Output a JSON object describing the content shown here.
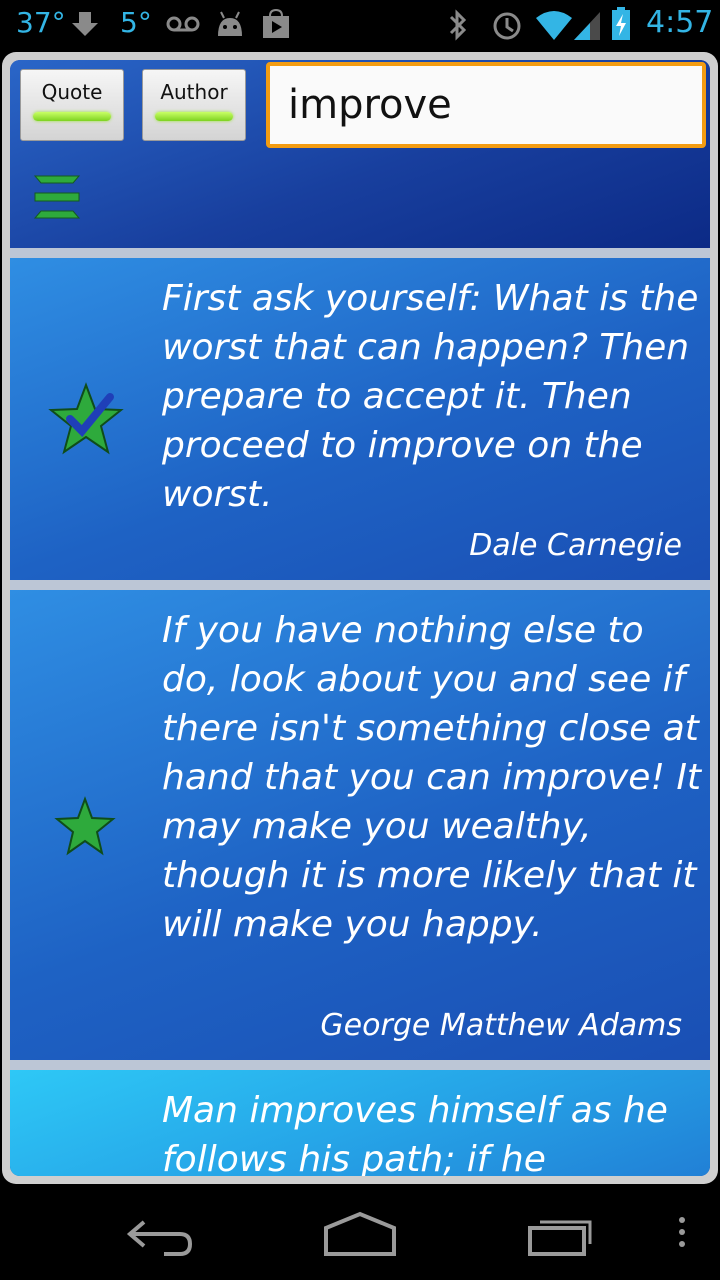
{
  "status_bar": {
    "temperature": "37°",
    "temperature2": "5°",
    "time": "4:57",
    "icons": [
      "download-icon",
      "voicemail-icon",
      "android-icon",
      "play-store-icon",
      "bluetooth-icon",
      "alarm-icon",
      "wifi-icon",
      "signal-icon",
      "battery-charging-icon"
    ]
  },
  "header": {
    "quote_button_label": "Quote",
    "author_button_label": "Author",
    "search_value": "improve",
    "collapse_icon": "collapse-icon"
  },
  "quotes": [
    {
      "text": "First ask yourself: What is the worst that can happen? Then prepare to accept it. Then proceed to improve on the worst.",
      "author": "Dale Carnegie",
      "favorite_icon": "star-check-icon"
    },
    {
      "text": "If you have nothing else to do, look about you and see if there isn't something close at hand that you can improve! It may make you wealthy, though it is more likely that it will make you happy.",
      "author": "George Matthew Adams",
      "favorite_icon": "star-icon"
    },
    {
      "text": "Man improves himself as he follows his path; if he",
      "author": "",
      "favorite_icon": ""
    }
  ],
  "nav_bar": {
    "icons": [
      "back-icon",
      "home-icon",
      "recent-apps-icon",
      "menu-icon"
    ]
  },
  "colors": {
    "accent": "#33b5e5",
    "search_border": "#f39c12",
    "button_bar": "#7ed321",
    "star_fill": "#2eaa3c"
  }
}
